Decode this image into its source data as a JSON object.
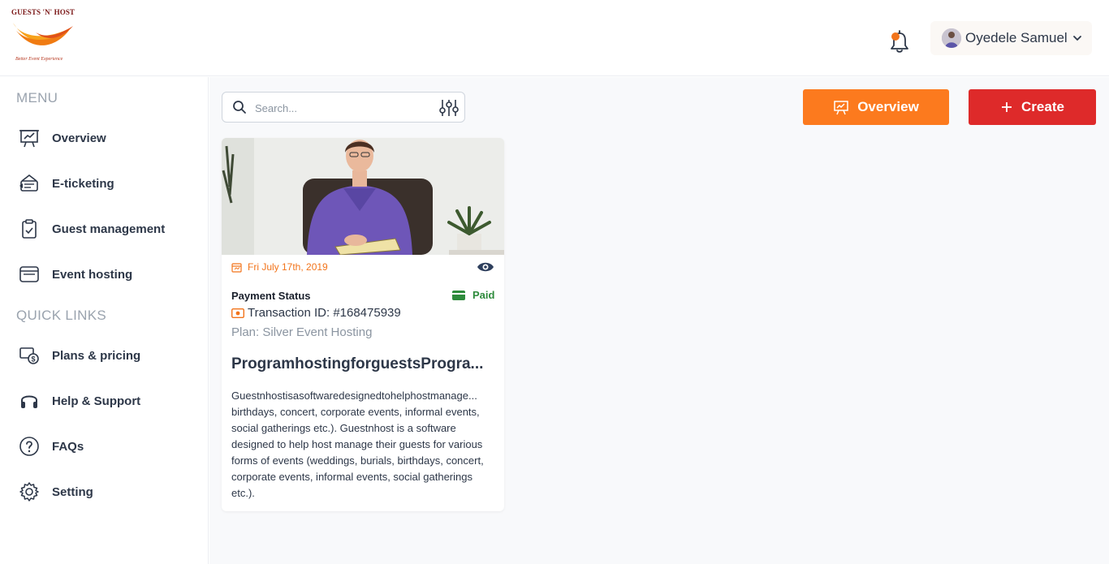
{
  "brand": {
    "name": "GUESTS 'N' HOST",
    "tagline": "Better Event Experience",
    "colors": {
      "orange": "#fc7a1e",
      "red": "#de2a2a",
      "green": "#2e8b3c",
      "dark": "#2d3748"
    }
  },
  "header": {
    "notification_icon": "bell-icon",
    "user": {
      "name": "Oyedele Samuel",
      "avatar_icon": "avatar"
    }
  },
  "sidebar": {
    "menu_title": "MENU",
    "menu_items": [
      {
        "label": "Overview",
        "icon": "presentation-chart-icon"
      },
      {
        "label": "E-ticketing",
        "icon": "ticket-icon"
      },
      {
        "label": "Guest management",
        "icon": "clipboard-check-icon"
      },
      {
        "label": "Event hosting",
        "icon": "browser-window-icon"
      }
    ],
    "quick_links_title": "QUICK LINKS",
    "quick_links": [
      {
        "label": "Plans & pricing",
        "icon": "dollar-cards-icon"
      },
      {
        "label": "Help & Support",
        "icon": "headset-icon"
      },
      {
        "label": "FAQs",
        "icon": "question-circle-icon"
      },
      {
        "label": "Setting",
        "icon": "gear-icon"
      }
    ]
  },
  "toolbar": {
    "search_placeholder": "Search...",
    "overview_label": "Overview",
    "create_label": "Create"
  },
  "event_card": {
    "date": "Fri July 17th, 2019",
    "payment_status_label": "Payment Status",
    "payment_status": "Paid",
    "transaction_id": "Transaction ID: #168475939",
    "plan": "Plan: Silver Event Hosting",
    "title": "ProgramhostingforguestsProgra...",
    "description_first_line": "Guestnhostisasoftwaredesignedtohelphostmanage...",
    "description_rest": "birthdays, concert, corporate events, informal events, social gatherings etc.). Guestnhost is a software designed to help host manage their guests for various forms of events (weddings, burials, birthdays, concert, corporate events, informal events, social gatherings etc.)."
  }
}
